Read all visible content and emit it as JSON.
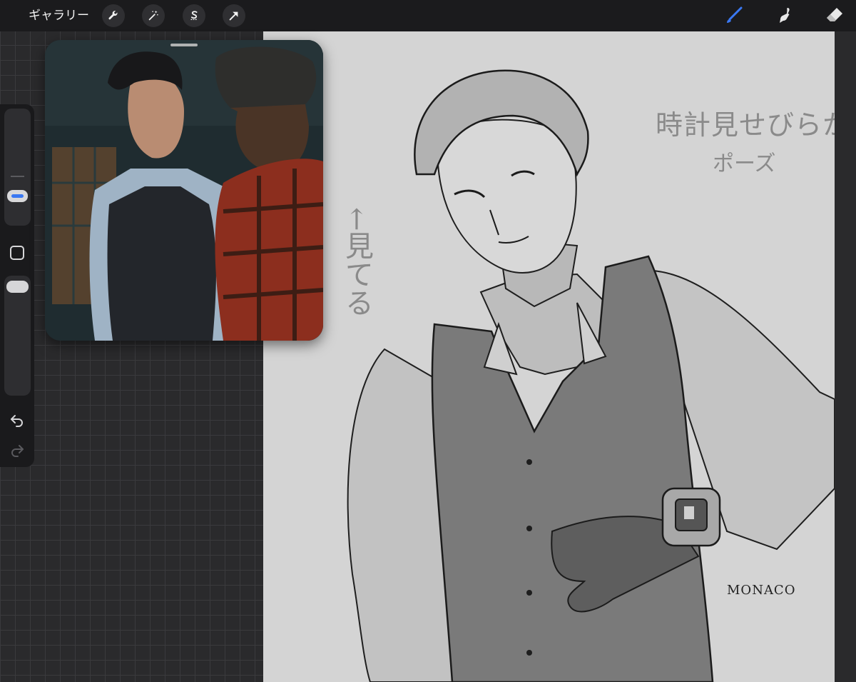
{
  "toolbar": {
    "gallery_label": "ギャラリー",
    "actions": [
      {
        "name": "wrench-icon"
      },
      {
        "name": "magic-wand-icon"
      },
      {
        "name": "selection-s-icon"
      },
      {
        "name": "transform-arrow-icon"
      }
    ],
    "tools": [
      {
        "name": "brush-icon",
        "active": true
      },
      {
        "name": "smudge-icon",
        "active": false
      },
      {
        "name": "eraser-icon",
        "active": false
      }
    ]
  },
  "sidebar": {
    "size_level": 0.3,
    "opacity_level": 0.95,
    "undo_icon": "undo-arrow-icon",
    "redo_icon": "redo-arrow-icon"
  },
  "canvas": {
    "note_watch": "時計見せびらかし",
    "note_pose": "ポーズ",
    "note_look": "←見てる",
    "watch_brand": "MONACO"
  },
  "colors": {
    "accent_blue": "#3a78f2",
    "topbar_bg": "#1b1b1d",
    "canvas_bg": "#d4d4d4",
    "grid_bg": "#2a2a2c"
  }
}
